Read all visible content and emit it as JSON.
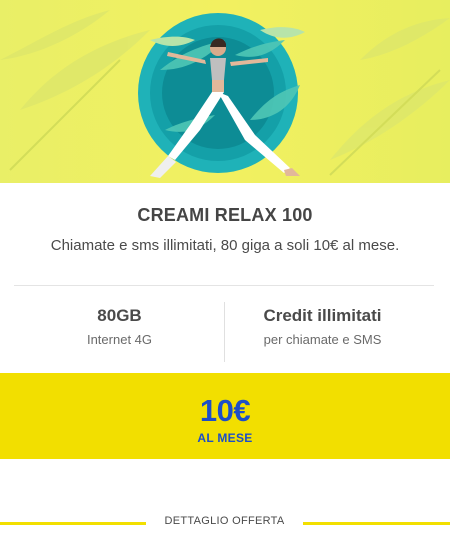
{
  "offer": {
    "title": "CREAMI RELAX 100",
    "description": "Chiamate e sms illimitati, 80 giga a soli 10€ al mese."
  },
  "features": [
    {
      "value": "80GB",
      "caption": "Internet 4G"
    },
    {
      "value": "Credit illimitati",
      "caption": "per chiamate e SMS"
    }
  ],
  "price": {
    "amount": "10€",
    "period": "AL MESE"
  },
  "detail_link": "DETTAGLIO OFFERTA",
  "colors": {
    "accent_yellow": "#f2df00",
    "price_blue": "#1d4ec7",
    "hero_teal": "#1fb2b8"
  },
  "icons": [
    "hero-yoga-illustration"
  ]
}
